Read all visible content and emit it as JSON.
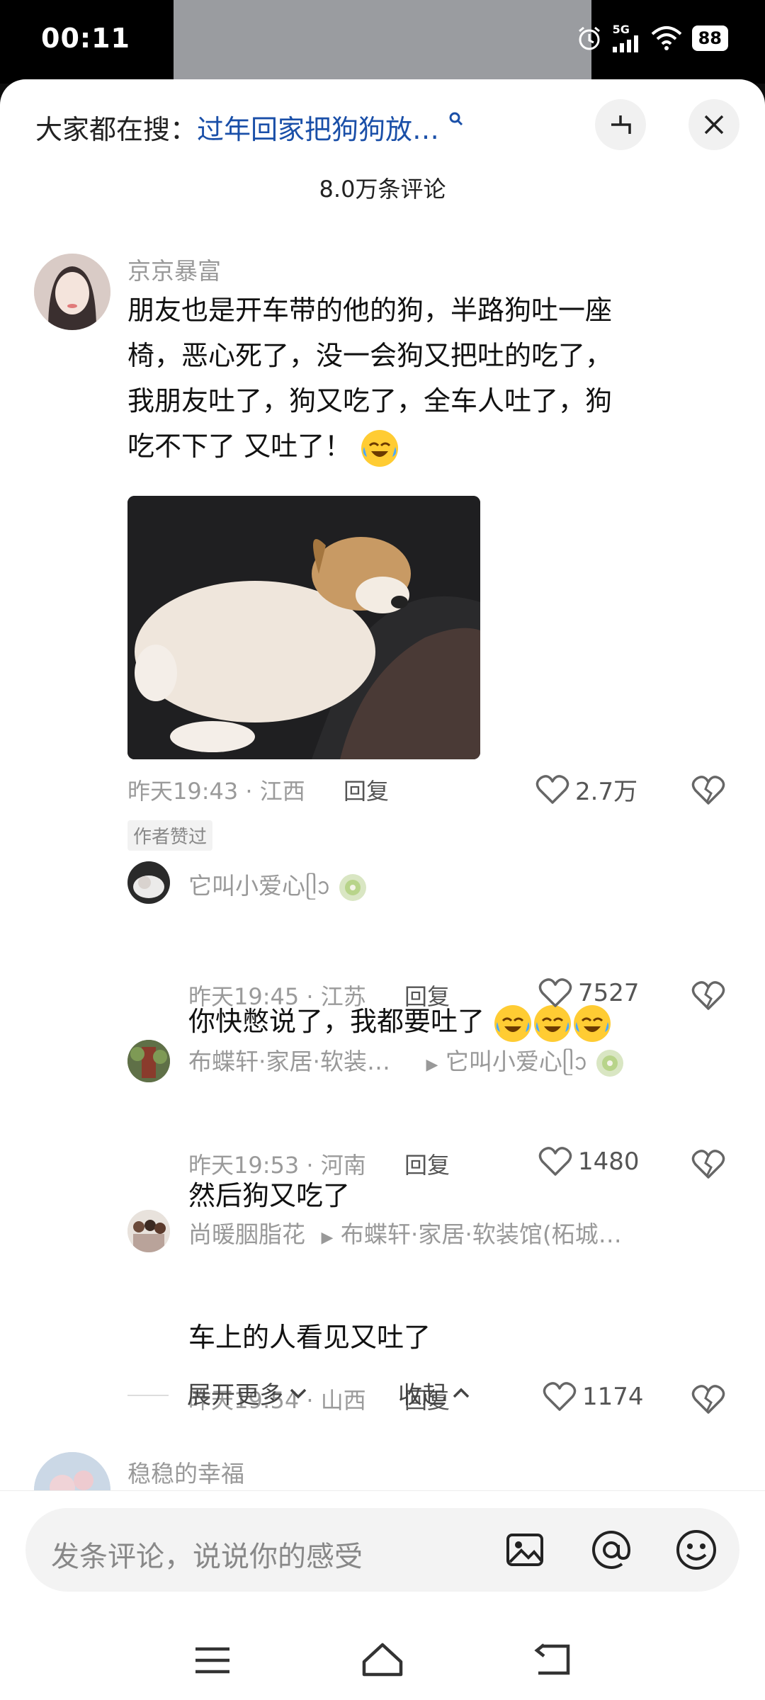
{
  "status": {
    "time": "00:11",
    "network": "5G",
    "battery": "88"
  },
  "search": {
    "prefix": "大家都在搜：",
    "query": "过年回家把狗狗放…"
  },
  "comments_count": "8.0万条评论",
  "main_comment": {
    "author": "京京暴富",
    "lines": [
      "朋友也是开车带的他的狗，半路狗吐一座",
      "椅，恶心死了，没一会狗又把吐的吃了，",
      "我朋友吐了，狗又吃了，全车人吐了，狗"
    ],
    "last_line": "吃不下了 又吐了！",
    "time": "昨天19:43",
    "location": "江西",
    "reply_label": "回复",
    "likes": "2.7万",
    "badge": "作者赞过"
  },
  "replies": [
    {
      "author": "它叫小爱心ᥫᩣ",
      "text": "你快憋说了，我都要吐了",
      "time": "昨天19:45",
      "location": "江苏",
      "reply_label": "回复",
      "likes": "7527"
    },
    {
      "author": "布蝶轩·家居·软装…",
      "reply_to": "它叫小爱心ᥫᩣ",
      "text": "然后狗又吃了",
      "time": "昨天19:53",
      "location": "河南",
      "reply_label": "回复",
      "likes": "1480"
    },
    {
      "author": "尚暖胭脂花",
      "reply_to": "布蝶轩·家居·软装馆(柘城…",
      "text": "车上的人看见又吐了",
      "time": "昨天19:54",
      "location": "山西",
      "reply_label": "回复",
      "likes": "1174"
    }
  ],
  "expand_more": "展开更多",
  "collapse": "收起",
  "next_comment": {
    "author": "稳稳的幸福"
  },
  "input": {
    "placeholder": "发条评论，说说你的感受"
  },
  "colors": {
    "accent": "#1a4fa8",
    "meta": "#9a9a9a",
    "sheet": "#ffffff"
  }
}
